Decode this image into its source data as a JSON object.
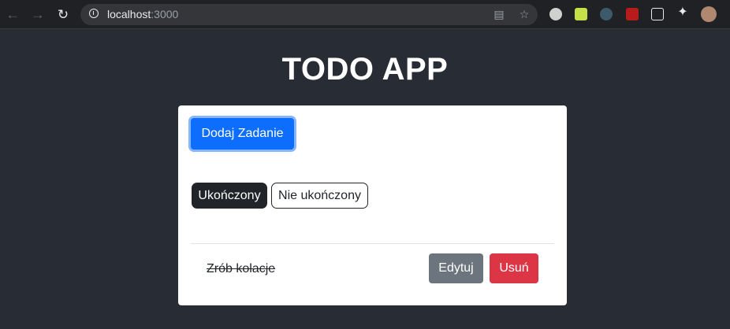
{
  "browser": {
    "url_host": "localhost",
    "url_port": ":3000",
    "back_icon": "arrow-left-icon",
    "forward_icon": "arrow-right-icon",
    "reload_icon": "reload-icon"
  },
  "app": {
    "title": "TODO APP",
    "add_button_label": "Dodaj Zadanie",
    "filters": [
      {
        "label": "Ukończony",
        "active": true
      },
      {
        "label": "Nie ukończony",
        "active": false
      }
    ],
    "tasks": [
      {
        "text": "Zrób kolacje",
        "completed": true,
        "edit_label": "Edytuj",
        "delete_label": "Usuń"
      }
    ]
  },
  "colors": {
    "page_background": "#282c34",
    "primary": "#0d6efd",
    "secondary": "#6c757d",
    "danger": "#dc3545",
    "dark": "#212529"
  }
}
